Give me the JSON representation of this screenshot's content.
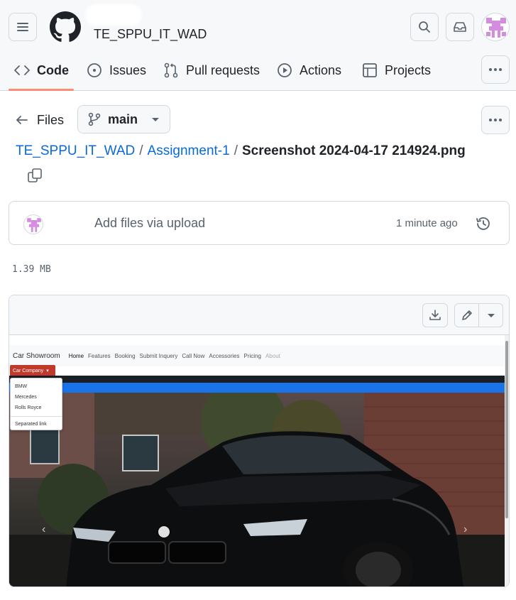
{
  "header": {
    "repo_title": "TE_SPPU_IT_WAD"
  },
  "tabs": [
    {
      "label": "Code",
      "icon": "code-icon",
      "active": true
    },
    {
      "label": "Issues",
      "icon": "issue-icon"
    },
    {
      "label": "Pull requests",
      "icon": "pull-request-icon"
    },
    {
      "label": "Actions",
      "icon": "play-icon"
    },
    {
      "label": "Projects",
      "icon": "table-icon"
    }
  ],
  "file_nav": {
    "files_label": "Files",
    "branch": "main"
  },
  "breadcrumb": {
    "repo": "TE_SPPU_IT_WAD",
    "folder": "Assignment-1",
    "file": "Screenshot 2024-04-17 214924.png",
    "separator": "/"
  },
  "commit": {
    "message": "Add files via upload",
    "time": "1 minute ago"
  },
  "file": {
    "size": "1.39 MB"
  },
  "preview": {
    "brand": "Car Showroom",
    "nav_items": [
      "Home",
      "Features",
      "Booking",
      "Submit Inquery",
      "Call Now",
      "Accessories",
      "Pricing",
      "About"
    ],
    "dropdown_button": "Car Company",
    "dropdown_items": [
      "BMW",
      "Mercedes",
      "Rolls Royce"
    ],
    "dropdown_separated": "Separated link",
    "prev_arrow": "‹",
    "next_arrow": "›"
  },
  "colors": {
    "accent_underline": "#fd8c73",
    "link": "#0969da",
    "border": "#d1d9e0"
  }
}
